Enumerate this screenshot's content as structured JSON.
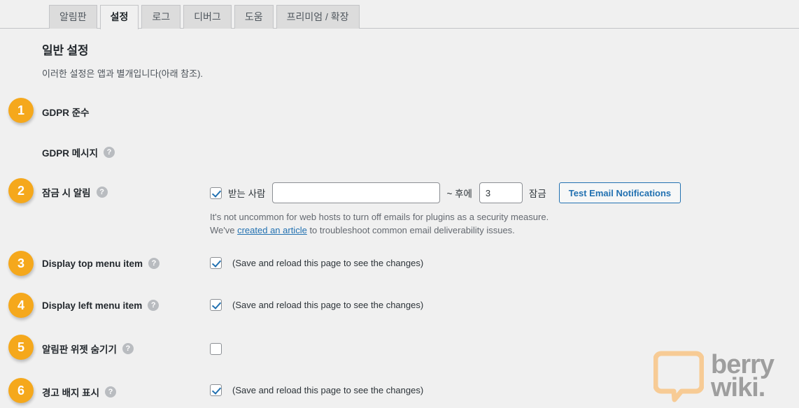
{
  "tabs": [
    {
      "label": "알림판",
      "active": false
    },
    {
      "label": "설정",
      "active": true
    },
    {
      "label": "로그",
      "active": false
    },
    {
      "label": "디버그",
      "active": false
    },
    {
      "label": "도움",
      "active": false
    },
    {
      "label": "프리미엄 / 확장",
      "active": false
    }
  ],
  "page": {
    "title": "일반 설정",
    "description": "이러한 설정은 앱과 별개입니다(아래 참조)."
  },
  "rows": [
    {
      "badge": "1",
      "label": "GDPR 준수",
      "help": false
    },
    {
      "badge": "",
      "label": "GDPR 메시지",
      "help": true,
      "help_glyph": "?"
    },
    {
      "badge": "2",
      "label": "잠금 시 알림",
      "help": true,
      "help_glyph": "?",
      "checkbox_checked": true,
      "recipient_label": "받는 사람",
      "email_value": "",
      "email_placeholder": "",
      "between_label": "~ 후에",
      "minutes_value": "3",
      "lock_label": "잠금",
      "test_button": "Test Email Notifications",
      "desc_line1": "It's not uncommon for web hosts to turn off emails for plugins as a security measure.",
      "desc_line2_prefix": "We've ",
      "desc_link": "created an article",
      "desc_line2_suffix": " to troubleshoot common email deliverability issues."
    },
    {
      "badge": "3",
      "label": "Display top menu item",
      "help": true,
      "help_glyph": "?",
      "checkbox_checked": true,
      "note": "(Save and reload this page to see the changes)"
    },
    {
      "badge": "4",
      "label": "Display left menu item",
      "help": true,
      "help_glyph": "?",
      "checkbox_checked": true,
      "note": "(Save and reload this page to see the changes)"
    },
    {
      "badge": "5",
      "label": "알림판 위젯 숨기기",
      "help": true,
      "help_glyph": "?",
      "checkbox_checked": false,
      "note": ""
    },
    {
      "badge": "6",
      "label": "경고 배지 표시",
      "help": true,
      "help_glyph": "?",
      "checkbox_checked": true,
      "note": "(Save and reload this page to see the changes)"
    }
  ],
  "watermark": {
    "line1": "berry",
    "line2": "wiki.",
    "icon": "speech-bubble-icon",
    "icon_color": "#f7cb95",
    "text_color": "#9e9e9e"
  },
  "colors": {
    "badge": "#f5a81c",
    "accent_link": "#2271b1",
    "page_bg": "#f0f0f0",
    "tab_inactive": "#dcdcdc",
    "border": "#c3c4c7"
  }
}
